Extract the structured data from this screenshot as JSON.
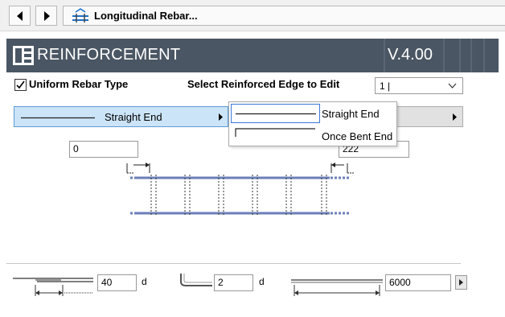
{
  "window": {
    "title": "Longitudinal Rebar..."
  },
  "header": {
    "title": "REINFORCEMENT",
    "version": "V.4.00"
  },
  "uniform": {
    "label": "Uniform Rebar Type",
    "checked": true
  },
  "edge": {
    "label": "Select Reinforced Edge to Edit",
    "value": "1 |"
  },
  "end_type": {
    "label": "Straight End"
  },
  "end_menu": {
    "options": [
      "Straight End",
      "Once Bent End"
    ],
    "selected": "Straight End"
  },
  "offsets": {
    "left": "0",
    "right": "222"
  },
  "bottom": {
    "lap_value": "40",
    "lap_unit": "d",
    "bend_value": "2",
    "bend_unit": "d",
    "length_value": "6000"
  },
  "colors": {
    "banner": "#4a5663",
    "rebar": "#6b7fb8",
    "selection": "#cce4f7"
  }
}
